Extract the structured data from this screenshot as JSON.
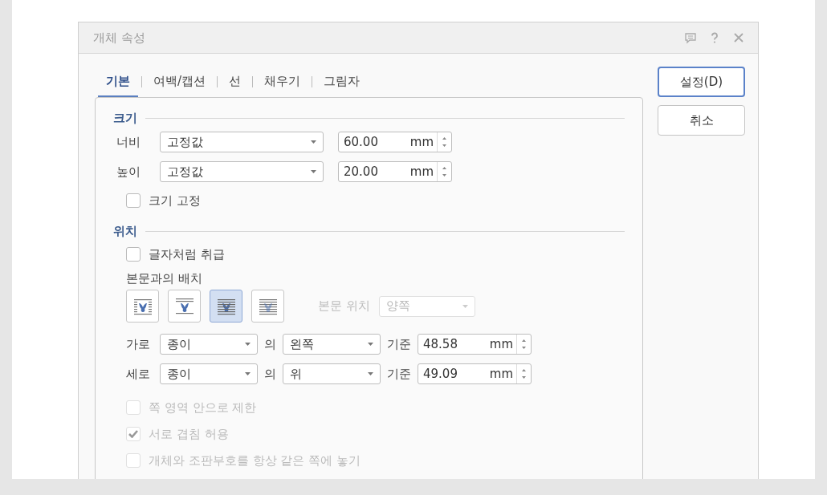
{
  "window": {
    "title": "개체 속성"
  },
  "tabs": [
    {
      "label": "기본",
      "selected": true
    },
    {
      "label": "여백/캡션",
      "selected": false
    },
    {
      "label": "선",
      "selected": false
    },
    {
      "label": "채우기",
      "selected": false
    },
    {
      "label": "그림자",
      "selected": false
    }
  ],
  "buttons": [
    {
      "label": "설정(D)",
      "default": true
    },
    {
      "label": "취소",
      "default": false
    }
  ],
  "size": {
    "heading": "크기",
    "rows": [
      {
        "label": "너비",
        "mode": "고정값",
        "value": "60.00",
        "unit": "mm"
      },
      {
        "label": "높이",
        "mode": "고정값",
        "value": "20.00",
        "unit": "mm"
      }
    ],
    "lock": {
      "label": "크기 고정",
      "checked": false
    }
  },
  "position": {
    "heading": "위치",
    "as_char": {
      "label": "글자처럼 취급",
      "checked": false
    },
    "wrap_label": "본문과의 배치",
    "wrap_options": [
      {
        "kind": "square",
        "selected": false
      },
      {
        "kind": "topbottom",
        "selected": false
      },
      {
        "kind": "behind",
        "selected": true
      },
      {
        "kind": "front",
        "selected": false
      }
    ],
    "text_side": {
      "label": "본문 위치",
      "value": "양쪽",
      "disabled": true
    },
    "offsets": [
      {
        "label": "가로",
        "relative_to": "종이",
        "joiner": "의",
        "anchor": "왼쪽",
        "base_label": "기준",
        "value": "48.58",
        "unit": "mm"
      },
      {
        "label": "세로",
        "relative_to": "종이",
        "joiner": "의",
        "anchor": "위",
        "base_label": "기준",
        "value": "49.09",
        "unit": "mm"
      }
    ],
    "options": [
      {
        "label": "쪽 영역 안으로 제한",
        "checked": false,
        "disabled": true
      },
      {
        "label": "서로 겹침 허용",
        "checked": true,
        "disabled": true
      },
      {
        "label": "개체와 조판부호를 항상 같은 쪽에 놓기",
        "checked": false,
        "disabled": true
      }
    ]
  }
}
